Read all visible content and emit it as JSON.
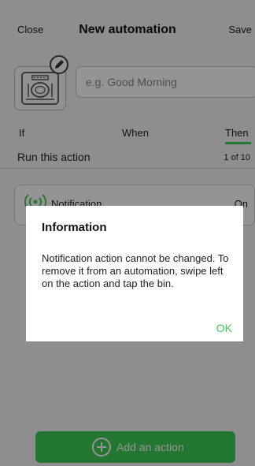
{
  "header": {
    "close_label": "Close",
    "title": "New automation",
    "save_label": "Save"
  },
  "automation": {
    "name_placeholder": "e.g. Good Morning",
    "icon": "dining-icon",
    "edit_icon": "pencil-icon"
  },
  "tabs": [
    {
      "label": "If"
    },
    {
      "label": "When"
    },
    {
      "label": "Then"
    }
  ],
  "active_tab": "Then",
  "section": {
    "title": "Run this action",
    "count": "1 of 10"
  },
  "action": {
    "icon": "notification-waves-icon",
    "label": "Notification",
    "state": "On"
  },
  "add_action": {
    "label": "Add an action",
    "icon": "plus-circle-icon"
  },
  "dialog": {
    "title": "Information",
    "body": "Notification action cannot be changed. To remove it from an automation, swipe left on the action and tap the bin.",
    "ok_label": "OK"
  },
  "colors": {
    "accent": "#3dcd58",
    "overlay": "rgba(0,0,0,0.42)"
  }
}
